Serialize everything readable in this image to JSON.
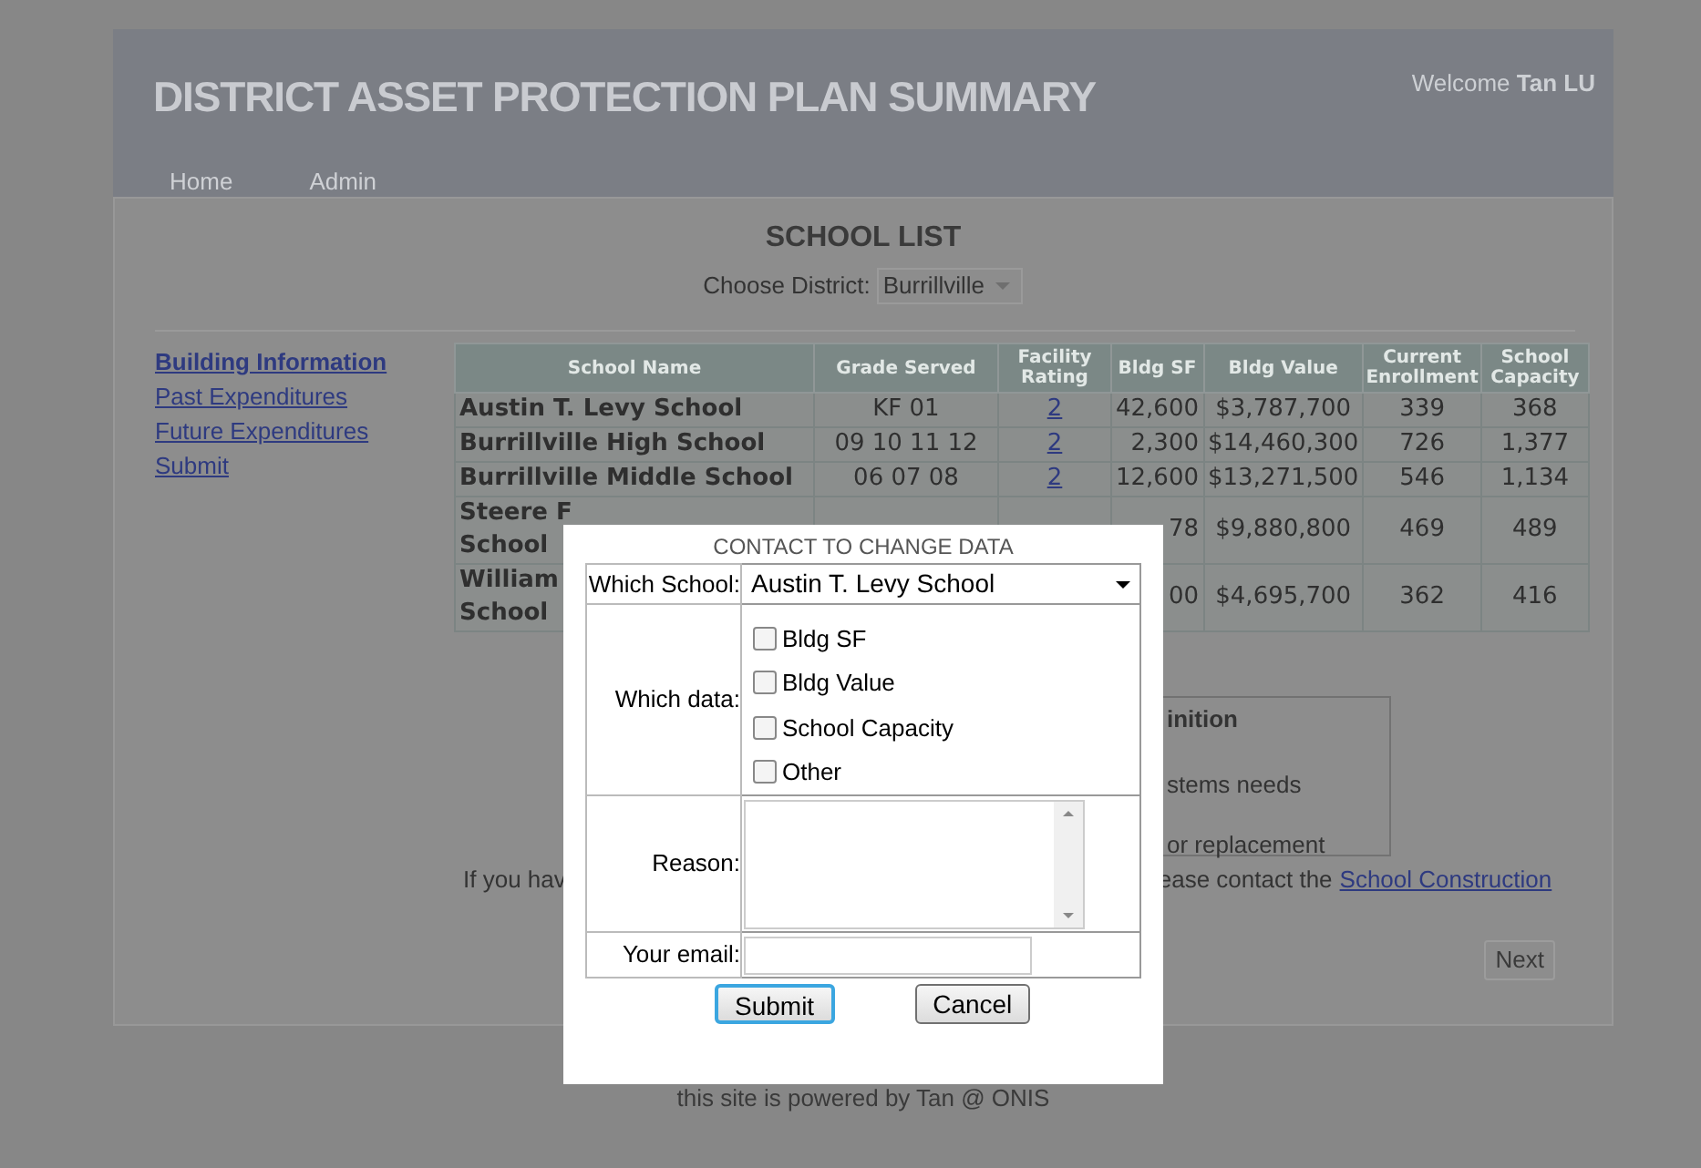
{
  "header": {
    "title": "DISTRICT ASSET PROTECTION PLAN SUMMARY",
    "welcome": "Welcome",
    "user": "Tan LU"
  },
  "nav": [
    {
      "label": "Home"
    },
    {
      "label": "Admin"
    }
  ],
  "page_title": "SCHOOL LIST",
  "district": {
    "label": "Choose District:",
    "value": "Burrillville"
  },
  "sidebar": [
    {
      "label": "Building Information",
      "selected": true
    },
    {
      "label": "Past Expenditures",
      "selected": false
    },
    {
      "label": "Future Expenditures",
      "selected": false
    },
    {
      "label": "Submit",
      "selected": false
    }
  ],
  "table": {
    "columns": [
      "School Name",
      "Grade Served",
      "Facility Rating",
      "Bldg SF",
      "Bldg Value",
      "Current Enrollment",
      "School Capacity"
    ],
    "rows": [
      {
        "name": "Austin T. Levy School",
        "grade": "KF 01",
        "rating": "2",
        "sf": "42,600",
        "value": "$3,787,700",
        "enrollment": "339",
        "capacity": "368"
      },
      {
        "name": "Burrillville High School",
        "grade": "09 10 11 12",
        "rating": "2",
        "sf": "2,300",
        "value": "$14,460,300",
        "enrollment": "726",
        "capacity": "1,377"
      },
      {
        "name": "Burrillville Middle School",
        "grade": "06 07 08",
        "rating": "2",
        "sf": "12,600",
        "value": "$13,271,500",
        "enrollment": "546",
        "capacity": "1,134"
      },
      {
        "name": "Steere F School",
        "sf": "78",
        "value": "$9,880,800",
        "enrollment": "469",
        "capacity": "489"
      },
      {
        "name": "William School",
        "sf": "00",
        "value": "$4,695,700",
        "enrollment": "362",
        "capacity": "416"
      }
    ]
  },
  "definition_box": {
    "title": "inition",
    "lines": [
      "stems needs",
      "or replacement"
    ]
  },
  "note": {
    "start": "If you hav",
    "middle": "ease contact the",
    "link": "School Construction"
  },
  "next_button": "Next",
  "footer": "this site is powered by Tan @ ONIS",
  "dialog": {
    "title": "CONTACT TO CHANGE DATA",
    "school": {
      "label": "Which School:",
      "value": "Austin T. Levy School"
    },
    "data": {
      "label": "Which data:",
      "options": [
        {
          "label": "Bldg SF",
          "checked": false
        },
        {
          "label": "Bldg Value",
          "checked": false
        },
        {
          "label": "School Capacity",
          "checked": false
        },
        {
          "label": "Other",
          "checked": false
        }
      ]
    },
    "reason": {
      "label": "Reason:"
    },
    "email": {
      "label": "Your email:"
    },
    "buttons": [
      {
        "label": "Submit",
        "focused": true
      },
      {
        "label": "Cancel",
        "focused": false
      }
    ]
  }
}
